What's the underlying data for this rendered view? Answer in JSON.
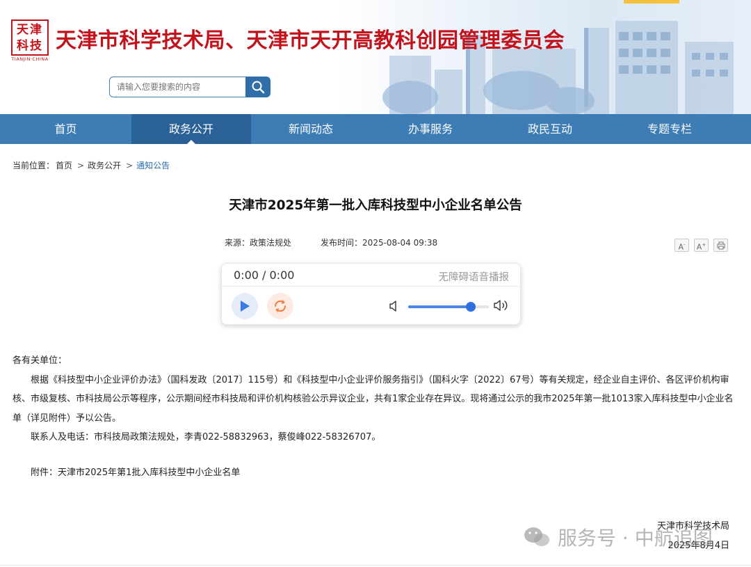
{
  "header": {
    "logo_text": "天津",
    "logo_sub": "科技",
    "logo_caption": "TIANJIN·CHINA",
    "site_title": "天津市科学技术局、天津市天开高教科创园管理委员会",
    "search_placeholder": "请输入您要搜索的内容"
  },
  "nav": {
    "items": [
      "首页",
      "政务公开",
      "新闻动态",
      "办事服务",
      "政民互动",
      "专题专栏"
    ],
    "active": "政务公开"
  },
  "breadcrumb": {
    "prefix": "当前位置：",
    "items": [
      "首页",
      "政务公开",
      "通知公告"
    ],
    "separator": ">"
  },
  "article": {
    "title": "天津市2025年第一批入库科技型中小企业名单公告",
    "source_label": "来源：",
    "source": "政策法规处",
    "time_label": "发布时间：",
    "time": "2025-08-04 09:38",
    "tools": [
      "A-",
      "A+",
      "print"
    ]
  },
  "player": {
    "time": "0:00 / 0:00",
    "label": "无障碍语音播报",
    "volume": 0.78
  },
  "content": {
    "salutation": "各有关单位：",
    "para1": "根据《科技型中小企业评价办法》（国科发政〔2017〕115号）和《科技型中小企业评价服务指引》（国科火字〔2022〕67号）等有关规定，经企业自主评价、各区评价机构审核、市级复核、市科技局公示等程序，公示期间经市科技局和评价机构核验公示异议企业，共有1家企业存在异议。现将通过公示的我市2025年第一批1013家入库科技型中小企业名单（详见附件）予以公告。",
    "contact": "联系人及电话：市科技局政策法规处，李青022-58832963，蔡俊峰022-58326707。",
    "attachment": "附件：天津市2025年第1批入库科技型中小企业名单",
    "sign_org": "天津市科学技术局",
    "sign_date": "2025年8月4日"
  },
  "watermark": {
    "text": "服务号 · 中航追图"
  }
}
